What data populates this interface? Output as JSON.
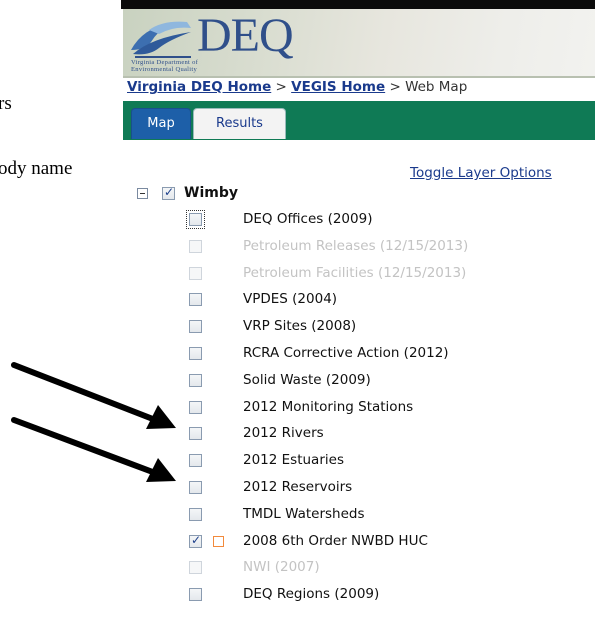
{
  "document": {
    "fragment1": "rs",
    "fragment2": "ody name"
  },
  "header": {
    "logo_text": "DEQ",
    "logo_sub_line1": "Virginia Department of",
    "logo_sub_line2": "Environmental Quality"
  },
  "breadcrumb": {
    "item1": "Virginia DEQ Home",
    "sep1": " > ",
    "item2": "VEGIS Home",
    "sep2": " > ",
    "current": "Web Map"
  },
  "tabs": {
    "map": "Map",
    "results": "Results"
  },
  "panel": {
    "toggle_label": "Toggle Layer Options",
    "root_label": "Wimby"
  },
  "layers": [
    {
      "label": "DEQ Offices (2009)",
      "checked": false,
      "enabled": true
    },
    {
      "label": "Petroleum Releases (12/15/2013)",
      "checked": false,
      "enabled": false
    },
    {
      "label": "Petroleum Facilities (12/15/2013)",
      "checked": false,
      "enabled": false
    },
    {
      "label": "VPDES (2004)",
      "checked": false,
      "enabled": true
    },
    {
      "label": "VRP Sites (2008)",
      "checked": false,
      "enabled": true
    },
    {
      "label": "RCRA Corrective Action (2012)",
      "checked": false,
      "enabled": true
    },
    {
      "label": "Solid Waste (2009)",
      "checked": false,
      "enabled": true
    },
    {
      "label": "2012 Monitoring Stations",
      "checked": false,
      "enabled": true
    },
    {
      "label": "2012 Rivers",
      "checked": false,
      "enabled": true
    },
    {
      "label": "2012 Estuaries",
      "checked": false,
      "enabled": true
    },
    {
      "label": "2012 Reservoirs",
      "checked": false,
      "enabled": true
    },
    {
      "label": "TMDL Watersheds",
      "checked": false,
      "enabled": true
    },
    {
      "label": "2008 6th Order NWBD HUC",
      "checked": true,
      "enabled": true
    },
    {
      "label": "NWI (2007)",
      "checked": false,
      "enabled": false
    },
    {
      "label": "DEQ Regions (2009)",
      "checked": false,
      "enabled": true
    }
  ],
  "colors": {
    "tab_bar": "#0f7a55",
    "link": "#1a3a8c",
    "legend_swatch": "#f28a3c"
  }
}
